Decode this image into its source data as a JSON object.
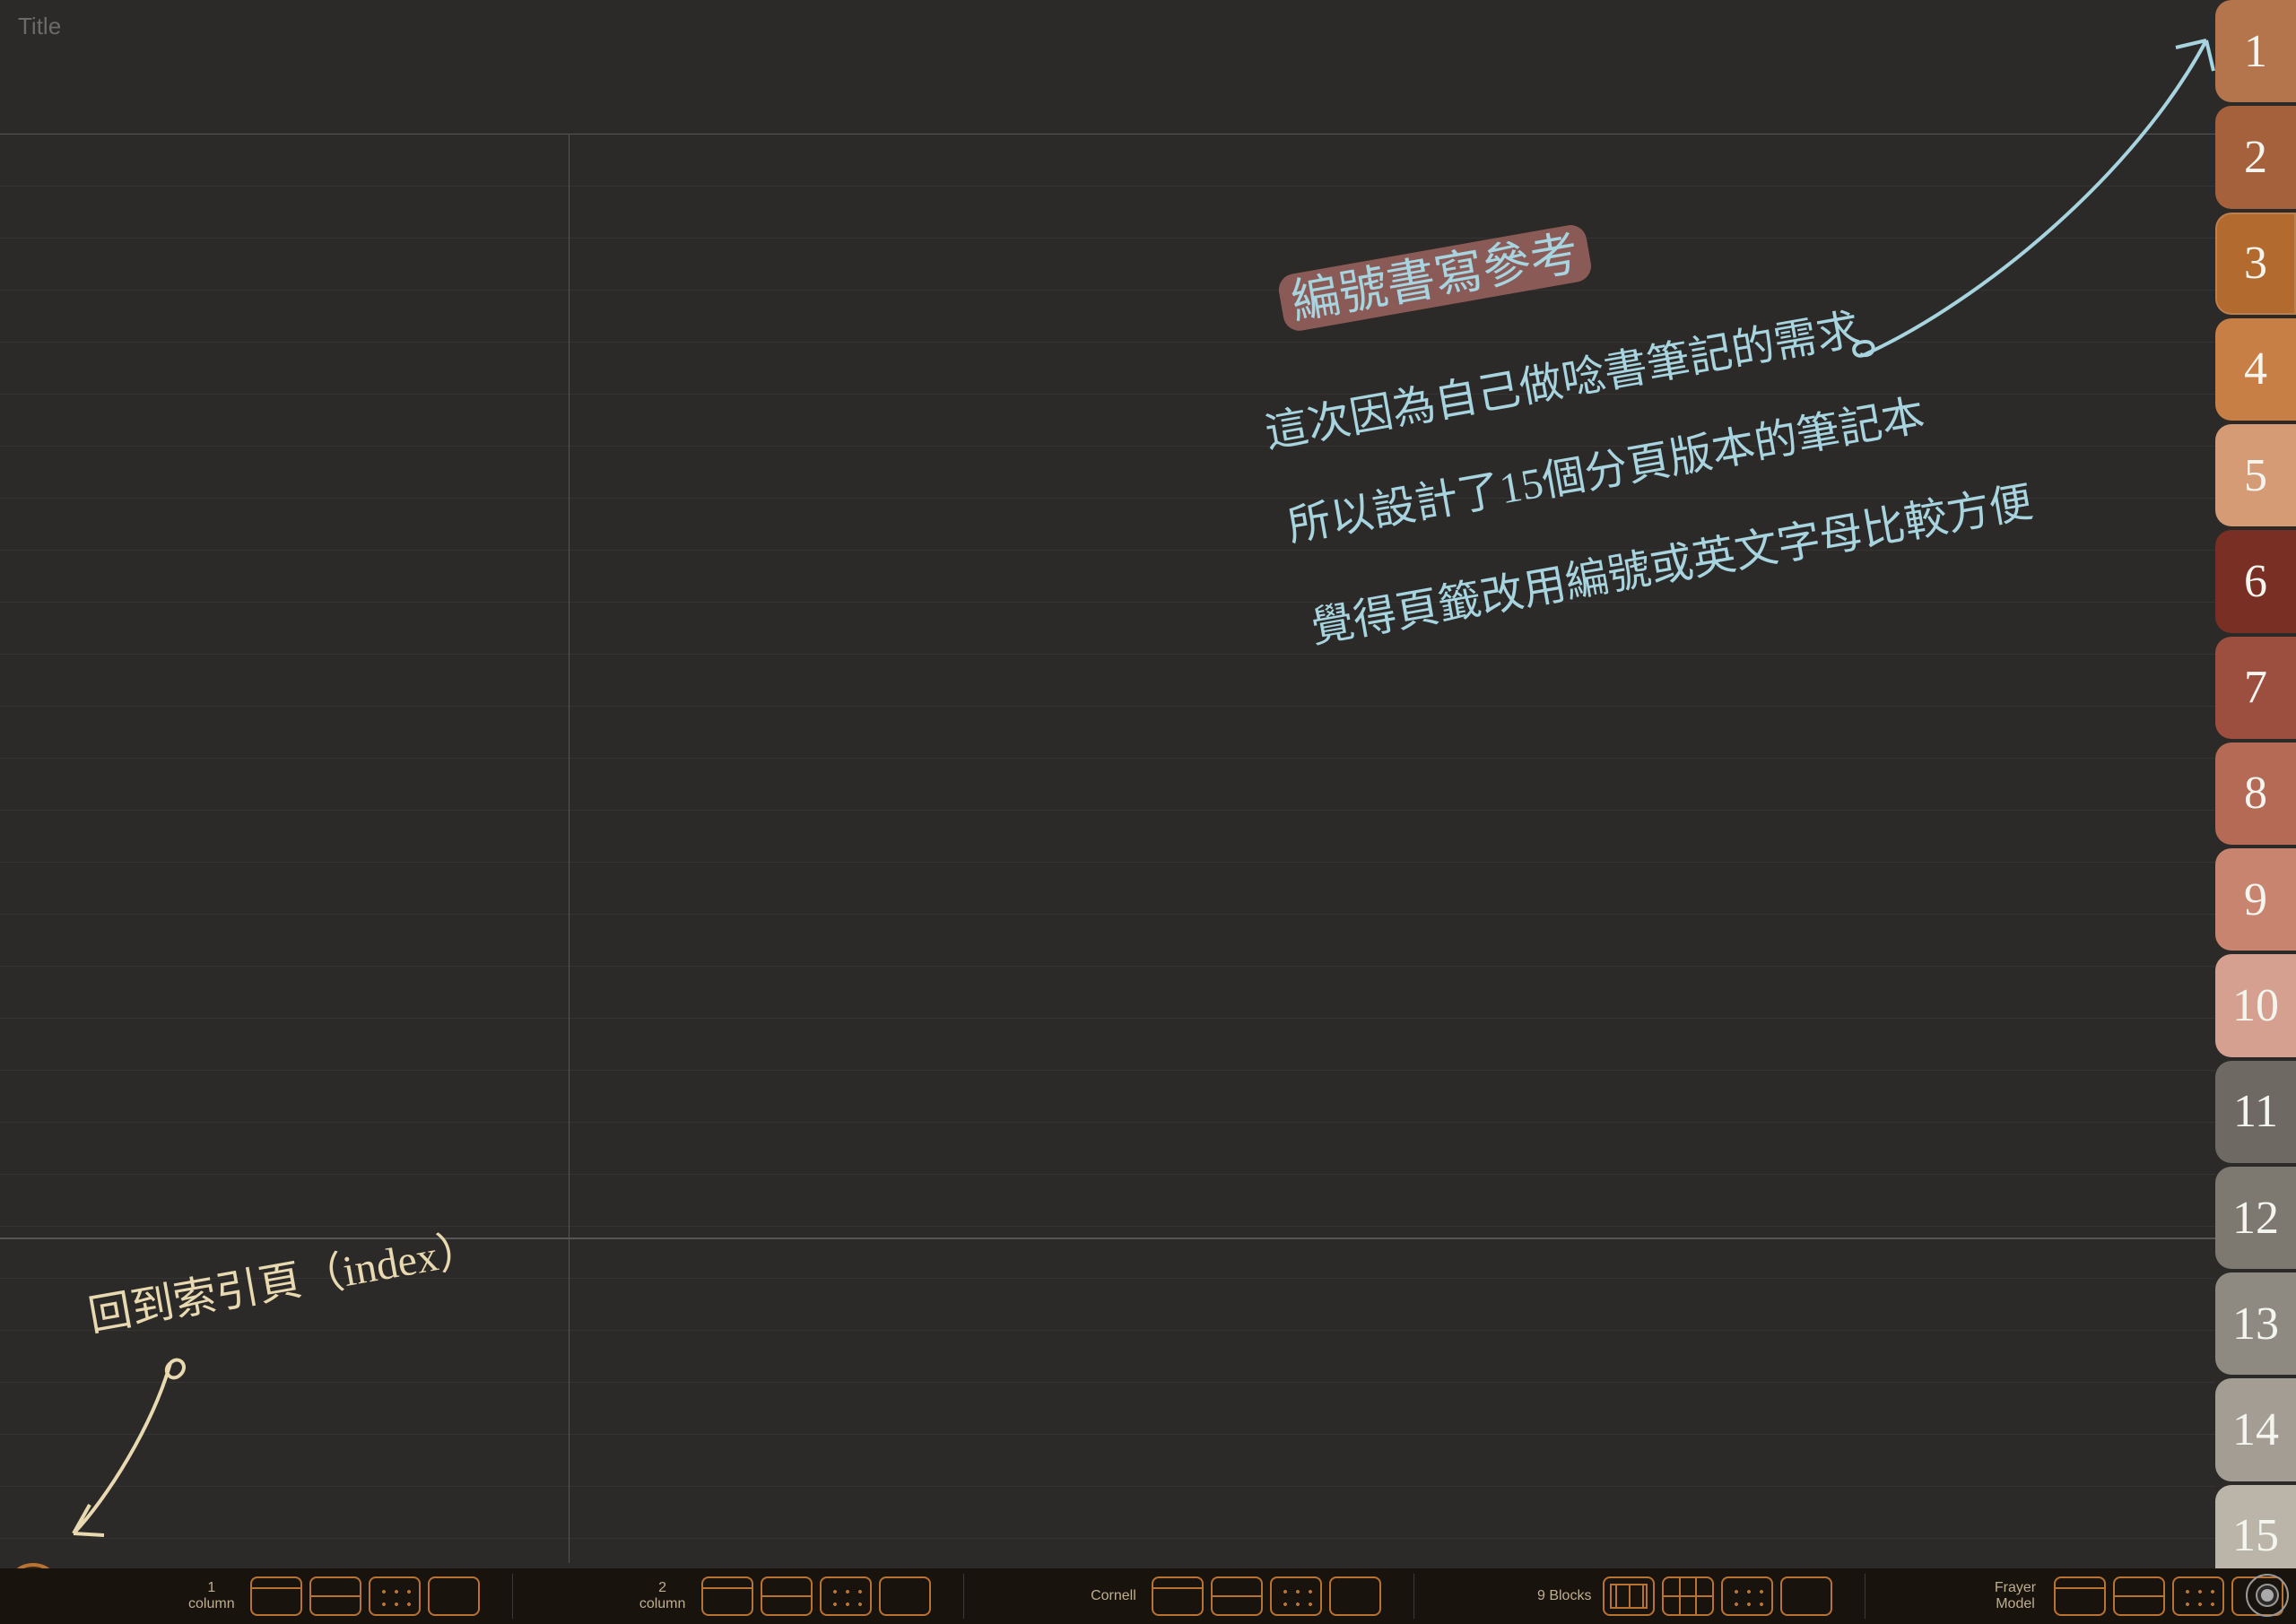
{
  "title_placeholder": "Title",
  "tabs": [
    {
      "num": "1",
      "color": "#b4754c"
    },
    {
      "num": "2",
      "color": "#a5613b"
    },
    {
      "num": "3",
      "color": "#b26a2e"
    },
    {
      "num": "4",
      "color": "#c77f45"
    },
    {
      "num": "5",
      "color": "#d49b74"
    },
    {
      "num": "6",
      "color": "#7a2f24"
    },
    {
      "num": "7",
      "color": "#9c4f3f"
    },
    {
      "num": "8",
      "color": "#b46a55"
    },
    {
      "num": "9",
      "color": "#c8846f"
    },
    {
      "num": "10",
      "color": "#d6a090"
    },
    {
      "num": "11",
      "color": "#6e6962"
    },
    {
      "num": "12",
      "color": "#7d7870"
    },
    {
      "num": "13",
      "color": "#8f8a81"
    },
    {
      "num": "14",
      "color": "#a39d93"
    },
    {
      "num": "15",
      "color": "#bab4a9"
    }
  ],
  "active_tab_index": 2,
  "handwriting": {
    "heading": "編號書寫參考",
    "line1": "這次因為自己做唸書筆記的需求",
    "line2": "所以設計了15個分頁版本的筆記本",
    "line3": "覺得頁籤改用編號或英文字母比較方便",
    "index_note": "回到索引頁（index）"
  },
  "toolbar": {
    "groups": [
      {
        "label": "1\ncolumn",
        "buttons": [
          "h-top",
          "h",
          "dots",
          "plain"
        ]
      },
      {
        "label": "2\ncolumn",
        "buttons": [
          "h-top",
          "h",
          "dots",
          "plain"
        ]
      },
      {
        "label": "Cornell",
        "buttons": [
          "h-top",
          "h",
          "dots",
          "plain"
        ]
      },
      {
        "label": "9 Blocks",
        "buttons": [
          "grid",
          "grid-h",
          "dots",
          "plain"
        ]
      },
      {
        "label": "Frayer\nModel",
        "buttons": [
          "h-top",
          "h",
          "dots",
          "plain"
        ]
      }
    ]
  }
}
